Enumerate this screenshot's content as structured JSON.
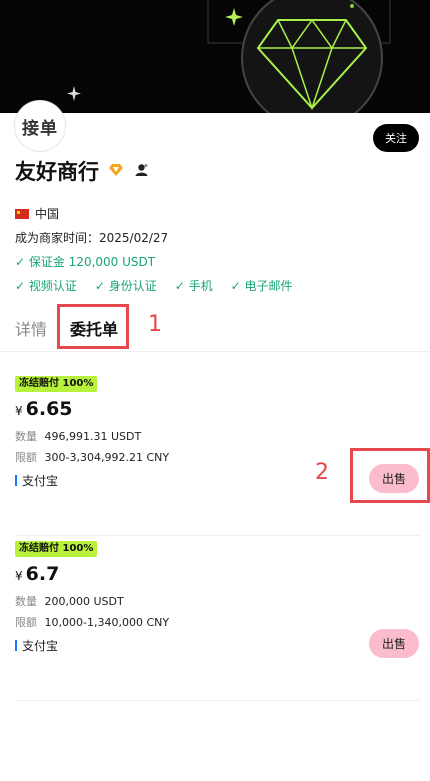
{
  "header": {
    "avatar_text": "接单",
    "follow_label": "关注"
  },
  "merchant": {
    "name": "友好商行",
    "country": "中国",
    "since": "成为商家时间：2025/02/27",
    "deposit": "✓ 保证金 120,000 USDT",
    "verifications": [
      "✓ 视频认证",
      "✓ 身份认证",
      "✓ 手机",
      "✓ 电子邮件"
    ]
  },
  "tabs": [
    "详情",
    "委托单"
  ],
  "annotations": [
    "1",
    "2"
  ],
  "orders": [
    {
      "tag": "冻结赔付 100%",
      "currency": "¥",
      "price": "6.65",
      "qty_label": "数量",
      "qty": "496,991.31 USDT",
      "limit_label": "限额",
      "limit": "300-3,304,992.21 CNY",
      "payment": "支付宝",
      "action": "出售"
    },
    {
      "tag": "冻结赔付 100%",
      "currency": "¥",
      "price": "6.7",
      "qty_label": "数量",
      "qty": "200,000 USDT",
      "limit_label": "限额",
      "limit": "10,000-1,340,000 CNY",
      "payment": "支付宝",
      "action": "出售"
    }
  ],
  "colors": {
    "accent_green": "#19a672",
    "tag_bg": "#b7f13a",
    "sell_button": "#fbbccd",
    "annotation": "#e5484d",
    "payment_bar": "#1677ff"
  }
}
